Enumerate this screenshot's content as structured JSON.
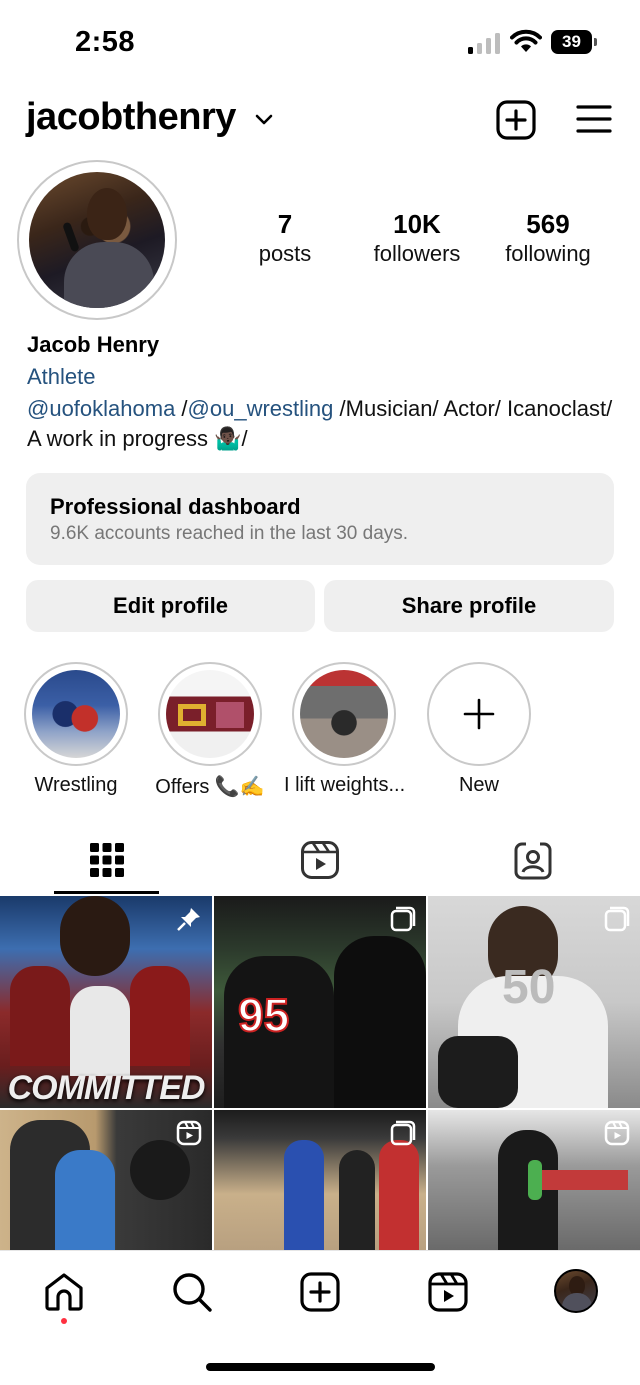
{
  "status_bar": {
    "time": "2:58",
    "battery": "39"
  },
  "header": {
    "username": "jacobthenry"
  },
  "stats": [
    {
      "value": "7",
      "label": "posts"
    },
    {
      "value": "10K",
      "label": "followers"
    },
    {
      "value": "569",
      "label": "following"
    }
  ],
  "bio": {
    "name": "Jacob Henry",
    "category": "Athlete",
    "mention1": "@uofoklahoma",
    "sep1": " /",
    "mention2": "@ou_wrestling",
    "text": " /Musician/ Actor/ Icanoclast/ A work in progress 🤷🏿‍♂️/"
  },
  "dashboard": {
    "title": "Professional dashboard",
    "subtitle": "9.6K accounts reached in the last 30 days."
  },
  "buttons": {
    "edit": "Edit profile",
    "share": "Share profile"
  },
  "highlights": [
    {
      "label": "Wrestling"
    },
    {
      "label": "Offers 📞✍️"
    },
    {
      "label": "I lift weights..."
    },
    {
      "label": "New"
    }
  ],
  "grid_posts": [
    {
      "caption_text": "COMMITTED",
      "badge": "pin-icon"
    },
    {
      "caption_text": "95",
      "badge": "multi-post-icon"
    },
    {
      "caption_text": "50",
      "badge": "multi-post-icon"
    },
    {
      "caption_text": "",
      "badge": "reel-icon"
    },
    {
      "caption_text": "",
      "badge": "multi-post-icon"
    },
    {
      "caption_text": "",
      "badge": "reel-icon"
    }
  ],
  "colors": {
    "link": "#25527e",
    "button_bg": "#efefef",
    "notification_dot": "#ff3040"
  }
}
